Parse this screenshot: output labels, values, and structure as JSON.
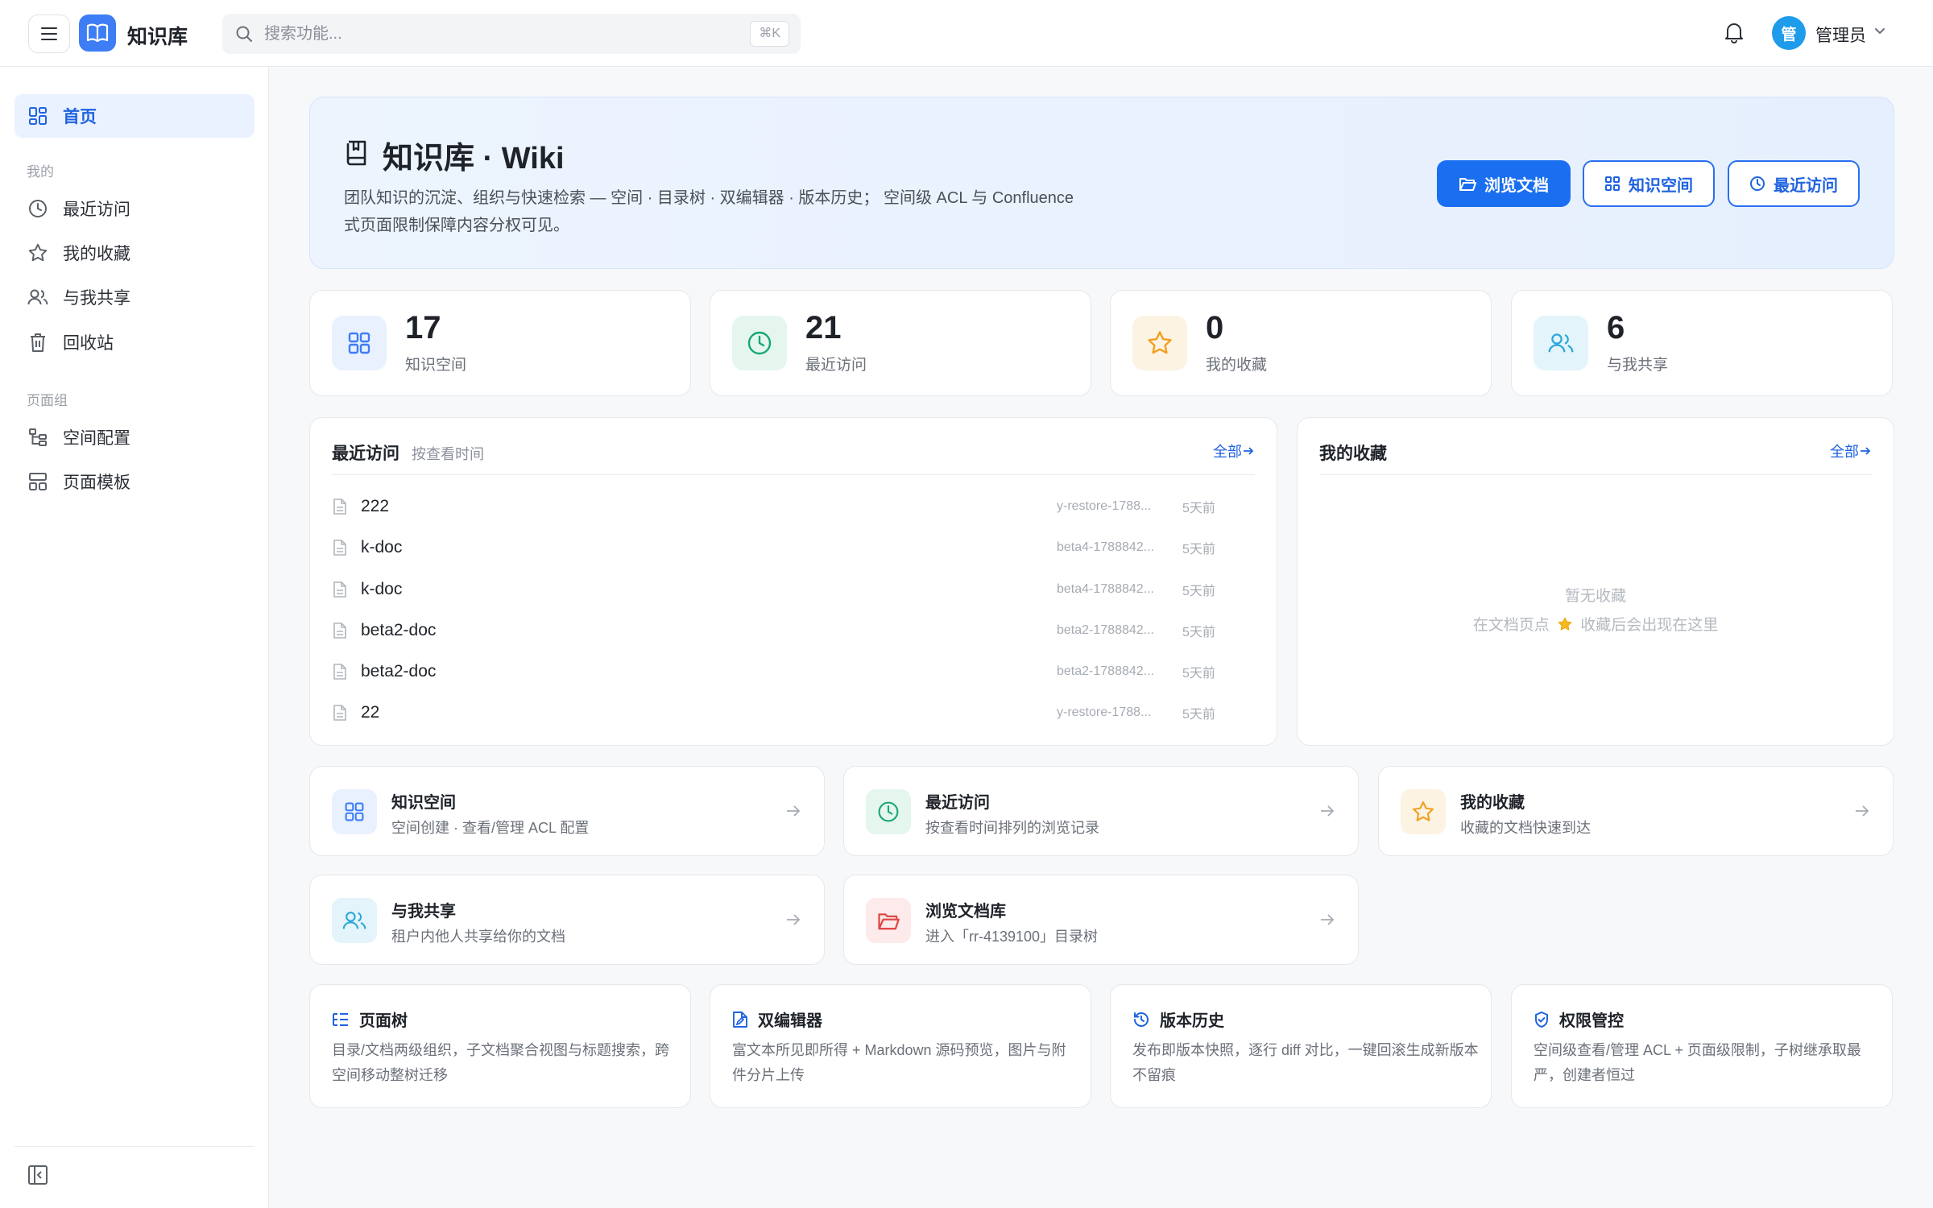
{
  "app": {
    "title": "知识库"
  },
  "search": {
    "placeholder": "搜索功能...",
    "shortcut": "⌘K"
  },
  "user": {
    "avatar_text": "管",
    "name": "管理员"
  },
  "sidebar": {
    "home": "首页",
    "group_mine": "我的",
    "mine_items": [
      {
        "label": "最近访问",
        "icon": "clock-icon"
      },
      {
        "label": "我的收藏",
        "icon": "star-icon"
      },
      {
        "label": "与我共享",
        "icon": "users-icon"
      },
      {
        "label": "回收站",
        "icon": "trash-icon"
      }
    ],
    "group_pages": "页面组",
    "page_items": [
      {
        "label": "空间配置",
        "icon": "tree-icon"
      },
      {
        "label": "页面模板",
        "icon": "template-icon"
      }
    ]
  },
  "hero": {
    "title": "知识库 · Wiki",
    "desc": "团队知识的沉淀、组织与快速检索 — 空间 · 目录树 · 双编辑器 · 版本历史；  空间级 ACL 与 Confluence 式页面限制保障内容分权可见。",
    "buttons": [
      "浏览文档",
      "知识空间",
      "最近访问"
    ]
  },
  "stats": [
    {
      "value": "17",
      "label": "知识空间",
      "icon": "grid-icon",
      "color": "#3d7df6",
      "bg": "#e9f1fe"
    },
    {
      "value": "21",
      "label": "最近访问",
      "icon": "clock-icon",
      "color": "#16a870",
      "bg": "#e5f6ee"
    },
    {
      "value": "0",
      "label": "我的收藏",
      "icon": "star-icon",
      "color": "#f0a020",
      "bg": "#fdf3e3"
    },
    {
      "value": "6",
      "label": "与我共享",
      "icon": "users-icon",
      "color": "#2aa8d8",
      "bg": "#e4f4fb"
    }
  ],
  "recent": {
    "title": "最近访问",
    "subtitle": "按查看时间",
    "more": "全部",
    "rows": [
      {
        "name": "222",
        "space": "y-restore-1788...",
        "time": "5天前"
      },
      {
        "name": "k-doc",
        "space": "beta4-1788842...",
        "time": "5天前"
      },
      {
        "name": "k-doc",
        "space": "beta4-1788842...",
        "time": "5天前"
      },
      {
        "name": "beta2-doc",
        "space": "beta2-1788842...",
        "time": "5天前"
      },
      {
        "name": "beta2-doc",
        "space": "beta2-1788842...",
        "time": "5天前"
      },
      {
        "name": "22",
        "space": "y-restore-1788...",
        "time": "5天前"
      }
    ]
  },
  "favorites": {
    "title": "我的收藏",
    "more": "全部",
    "empty_title": "暂无收藏",
    "empty_hint_before": "在文档页点",
    "empty_hint_after": "收藏后会出现在这里"
  },
  "nav_cards": [
    {
      "title": "知识空间",
      "desc": "空间创建 · 查看/管理 ACL 配置",
      "icon": "grid-icon",
      "color": "#3d7df6",
      "bg": "#e9f1fe"
    },
    {
      "title": "最近访问",
      "desc": "按查看时间排列的浏览记录",
      "icon": "clock-icon",
      "color": "#16a870",
      "bg": "#e5f6ee"
    },
    {
      "title": "我的收藏",
      "desc": "收藏的文档快速到达",
      "icon": "star-icon",
      "color": "#f0a020",
      "bg": "#fdf3e3"
    },
    {
      "title": "与我共享",
      "desc": "租户内他人共享给你的文档",
      "icon": "users-icon",
      "color": "#2aa8d8",
      "bg": "#e4f4fb"
    },
    {
      "title": "浏览文档库",
      "desc": "进入「rr-4139100」目录树",
      "icon": "folder-open-icon",
      "color": "#e04848",
      "bg": "#fdeaea"
    }
  ],
  "features": [
    {
      "title": "页面树",
      "desc": "目录/文档两级组织，子文档聚合视图与标题搜索，跨空间移动整树迁移",
      "icon": "list-tree-icon"
    },
    {
      "title": "双编辑器",
      "desc": "富文本所见即所得 + Markdown 源码预览，图片与附件分片上传",
      "icon": "edit-doc-icon"
    },
    {
      "title": "版本历史",
      "desc": "发布即版本快照，逐行 diff 对比，一键回滚生成新版本不留痕",
      "icon": "history-icon"
    },
    {
      "title": "权限管控",
      "desc": "空间级查看/管理 ACL + 页面级限制，子树继承取最严，创建者恒过",
      "icon": "shield-check-icon"
    }
  ]
}
